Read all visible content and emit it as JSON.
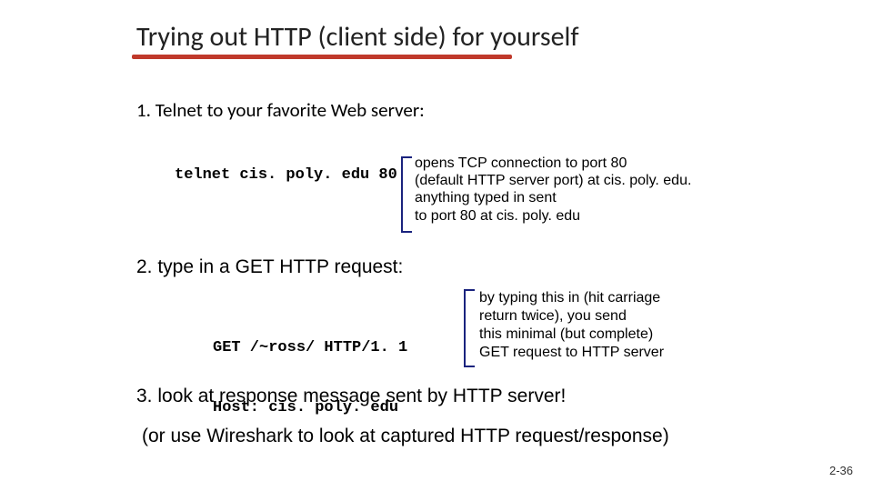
{
  "title": "Trying out HTTP (client side) for yourself",
  "step1": "1. Telnet to your favorite Web server:",
  "code1": "telnet cis. poly. edu 80",
  "note1_l1": "opens TCP connection to port 80",
  "note1_l2": "(default HTTP server port) at cis. poly. edu.",
  "note1_l3": "anything typed in sent",
  "note1_l4": "to port 80 at cis. poly. edu",
  "step2": "2. type in a GET HTTP request:",
  "code2_l1": "GET /~ross/ HTTP/1. 1",
  "code2_l2": "Host: cis. poly. edu",
  "note2_l1": "by typing this in (hit carriage",
  "note2_l2": "return twice), you send",
  "note2_l3": "this minimal (but complete)",
  "note2_l4": "GET request to HTTP server",
  "step3": "3. look at response message sent by HTTP server!",
  "wireshark": "(or use Wireshark to look at captured HTTP request/response)",
  "slidenum": "2-36"
}
